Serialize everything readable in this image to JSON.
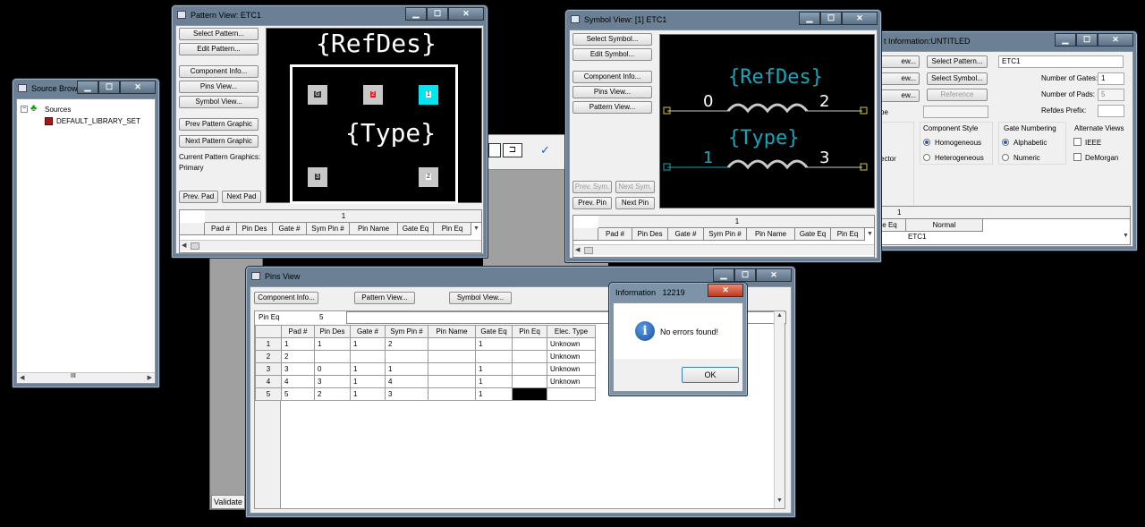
{
  "source_browser": {
    "title": "Source Browser",
    "tree_root": "Sources",
    "tree_child": "DEFAULT_LIBRARY_SET",
    "scroll_marker": "III"
  },
  "pattern_view": {
    "title": "Pattern View: ETC1",
    "buttons": {
      "select_pattern": "Select Pattern...",
      "edit_pattern": "Edit Pattern...",
      "component_info": "Component Info...",
      "pins_view": "Pins View...",
      "symbol_view": "Symbol View...",
      "prev_graphic": "Prev Pattern Graphic",
      "next_graphic": "Next Pattern Graphic",
      "prev_pad": "Prev. Pad",
      "next_pad": "Next Pad"
    },
    "current_graphics_label": "Current Pattern Graphics:",
    "current_graphics_value": "Primary",
    "canvas": {
      "refdes": "{RefDes}",
      "type": "{Type}",
      "pads": [
        "G",
        "2",
        "1",
        "3",
        "2"
      ]
    },
    "grid_row_number": "1",
    "grid_columns": [
      "Pad #",
      "Pin Des",
      "Gate #",
      "Sym Pin #",
      "Pin Name",
      "Gate Eq",
      "Pin Eq"
    ]
  },
  "symbol_view": {
    "title": "Symbol View: [1] ETC1",
    "buttons": {
      "select_symbol": "Select Symbol...",
      "edit_symbol": "Edit Symbol...",
      "component_info": "Component Info...",
      "pins_view": "Pins View...",
      "pattern_view": "Pattern View...",
      "prev_sym": "Prev. Sym.",
      "next_sym": "Next Sym.",
      "prev_pin": "Prev. Pin",
      "next_pin": "Next Pin"
    },
    "canvas": {
      "refdes": "{RefDes}",
      "type": "{Type}",
      "pin_0": "0",
      "pin_2": "2",
      "pin_1": "1",
      "pin_3": "3"
    },
    "grid_row_number": "1",
    "grid_columns": [
      "Pad #",
      "Pin Des",
      "Gate #",
      "Sym Pin #",
      "Pin Name",
      "Gate Eq",
      "Pin Eq"
    ]
  },
  "component_info": {
    "title": "t Information:UNTITLED",
    "left_stubs": [
      "ew...",
      "ew...",
      "ew..."
    ],
    "select_pattern": "Select Pattern...",
    "select_symbol": "Select Symbol...",
    "reference": "Reference",
    "name_value": "ETC1",
    "number_of_gates_label": "Number of Gates:",
    "number_of_gates": "1",
    "number_of_pads_label": "Number of Pads:",
    "number_of_pads": "5",
    "refdes_prefix_label": "Refdes Prefix:",
    "refdes_prefix": "",
    "type_stub": "pe",
    "vector_stub": "ector",
    "component_style_label": "Component Style",
    "homogeneous": "Homogeneous",
    "heterogeneous": "Heterogeneous",
    "gate_numbering_label": "Gate Numbering",
    "alphabetic": "Alphabetic",
    "numeric": "Numeric",
    "alternate_views_label": "Alternate Views",
    "ieee": "IEEE",
    "demorgan": "DeMorgan",
    "grid_row_number": "1",
    "grid_col_gate_eq": "e Eq",
    "grid_col_normal": "Normal",
    "grid_cell_value": "ETC1"
  },
  "pins_view": {
    "title": "Pins View",
    "buttons": {
      "component_info": "Component Info...",
      "pattern_view": "Pattern View...",
      "symbol_view": "Symbol View..."
    },
    "pin_eq_label": "Pin Eq",
    "pin_eq_value": "5",
    "columns": [
      "Pad #",
      "Pin Des",
      "Gate #",
      "Sym Pin #",
      "Pin Name",
      "Gate Eq",
      "Pin Eq",
      "Elec. Type"
    ],
    "rows": [
      {
        "n": "1",
        "pad": "1",
        "pin_des": "1",
        "gate": "1",
        "sym_pin": "2",
        "pin_name": "",
        "gate_eq": "1",
        "pin_eq": "",
        "elec": "Unknown"
      },
      {
        "n": "2",
        "pad": "2",
        "pin_des": "",
        "gate": "",
        "sym_pin": "",
        "pin_name": "",
        "gate_eq": "",
        "pin_eq": "",
        "elec": "Unknown"
      },
      {
        "n": "3",
        "pad": "3",
        "pin_des": "0",
        "gate": "1",
        "sym_pin": "1",
        "pin_name": "",
        "gate_eq": "1",
        "pin_eq": "",
        "elec": "Unknown"
      },
      {
        "n": "4",
        "pad": "4",
        "pin_des": "3",
        "gate": "1",
        "sym_pin": "4",
        "pin_name": "",
        "gate_eq": "1",
        "pin_eq": "",
        "elec": "Unknown"
      },
      {
        "n": "5",
        "pad": "5",
        "pin_des": "2",
        "gate": "1",
        "sym_pin": "3",
        "pin_name": "",
        "gate_eq": "1",
        "pin_eq": "",
        "elec": ""
      }
    ]
  },
  "information_dialog": {
    "title": "Information",
    "code": "12219",
    "message": "No errors found!",
    "ok": "OK"
  },
  "background_window": {
    "validate_label": "Validate"
  },
  "colors": {
    "pad_selected": "#00e5ee",
    "pad_red": "#e41b1b",
    "symbol_cyan": "#16a6b6",
    "pin_yellow": "#d4c642"
  }
}
